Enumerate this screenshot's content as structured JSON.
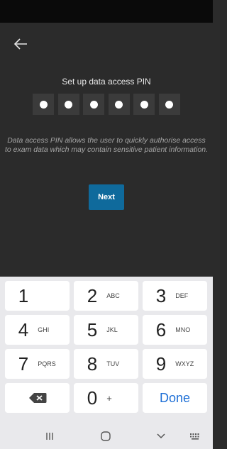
{
  "screen": {
    "title": "Set up data access PIN",
    "pin_length": 6,
    "description": "Data access PIN allows the user to quickly authorise access to exam data which may contain sensitive patient information.",
    "next_label": "Next",
    "colors": {
      "background": "#2b2b2b",
      "accent": "#0f6a9c",
      "pin_box": "#3b3b3b"
    }
  },
  "keyboard": {
    "keys": [
      {
        "digit": "1",
        "letters": ""
      },
      {
        "digit": "2",
        "letters": "ABC"
      },
      {
        "digit": "3",
        "letters": "DEF"
      },
      {
        "digit": "4",
        "letters": "GHI"
      },
      {
        "digit": "5",
        "letters": "JKL"
      },
      {
        "digit": "6",
        "letters": "MNO"
      },
      {
        "digit": "7",
        "letters": "PQRS"
      },
      {
        "digit": "8",
        "letters": "TUV"
      },
      {
        "digit": "9",
        "letters": "WXYZ"
      }
    ],
    "backspace_icon": "backspace-icon",
    "zero": {
      "digit": "0",
      "extra": "+"
    },
    "done_label": "Done"
  },
  "nav": {
    "icons": [
      "recents-icon",
      "home-icon",
      "back-chevron-icon",
      "keyboard-icon"
    ]
  }
}
